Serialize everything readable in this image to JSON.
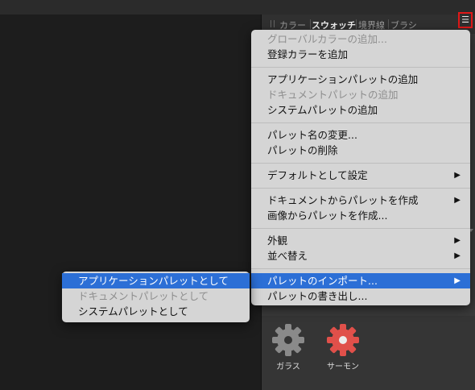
{
  "panel": {
    "tabs": [
      {
        "label": "カラー",
        "active": false
      },
      {
        "label": "スウォッチ",
        "active": true
      },
      {
        "label": "境界線",
        "active": false
      },
      {
        "label": "ブラシ",
        "active": false
      }
    ],
    "menu_icon": "hamburger-menu-icon",
    "swatches": [
      {
        "label": "ガラス",
        "color": "#8a8a8a",
        "icon": "gear-icon"
      },
      {
        "label": "サーモン",
        "color": "#e0504a",
        "icon": "gear-icon"
      }
    ]
  },
  "menu": {
    "groups": [
      [
        {
          "label": "グローバルカラーの追加...",
          "disabled": true
        },
        {
          "label": "登録カラーを追加",
          "disabled": false
        }
      ],
      [
        {
          "label": "アプリケーションパレットの追加",
          "disabled": false
        },
        {
          "label": "ドキュメントパレットの追加",
          "disabled": true
        },
        {
          "label": "システムパレットの追加",
          "disabled": false
        }
      ],
      [
        {
          "label": "パレット名の変更...",
          "disabled": false
        },
        {
          "label": "パレットの削除",
          "disabled": false
        }
      ],
      [
        {
          "label": "デフォルトとして設定",
          "disabled": false,
          "submenu": true
        }
      ],
      [
        {
          "label": "ドキュメントからパレットを作成",
          "disabled": false,
          "submenu": true
        },
        {
          "label": "画像からパレットを作成...",
          "disabled": false
        }
      ],
      [
        {
          "label": "外観",
          "disabled": false,
          "submenu": true
        },
        {
          "label": "並べ替え",
          "disabled": false,
          "submenu": true
        }
      ],
      [
        {
          "label": "パレットのインポート...",
          "disabled": false,
          "submenu": true,
          "highlighted": true
        },
        {
          "label": "パレットの書き出し...",
          "disabled": false
        }
      ]
    ],
    "submenu_arrow": "▶"
  },
  "import_submenu": [
    {
      "label": "アプリケーションパレットとして",
      "disabled": false
    },
    {
      "label": "ドキュメントパレットとして",
      "disabled": true
    },
    {
      "label": "システムパレットとして",
      "disabled": false
    }
  ],
  "colors": {
    "highlight": "#2c6fd6",
    "menu_bg": "#d5d5d5",
    "app_bg": "#1e1e1e",
    "panel_bg": "#3a3a3a",
    "menu_button_outline": "#e01818"
  }
}
